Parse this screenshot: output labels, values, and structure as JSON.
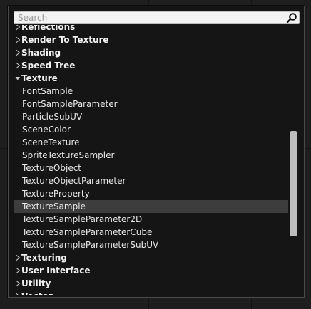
{
  "search": {
    "placeholder": "Search",
    "value": ""
  },
  "icons": {
    "search": "magnifier-icon",
    "collapsed": "triangle-right-outline-icon",
    "expanded": "triangle-down-filled-icon"
  },
  "colors": {
    "panel_bg": "#151515",
    "selection": "#3d3d3d",
    "scrollbar_thumb": "#bdbdbd",
    "search_bg": "#f2f2f2"
  },
  "scrollbar": {
    "position_fraction": 0.58,
    "visible_fraction": 0.4
  },
  "list": {
    "rows": [
      {
        "type": "category",
        "label": "Reflections",
        "expanded": false
      },
      {
        "type": "category",
        "label": "Render To Texture",
        "expanded": false
      },
      {
        "type": "category",
        "label": "Shading",
        "expanded": false
      },
      {
        "type": "category",
        "label": "Speed Tree",
        "expanded": false
      },
      {
        "type": "category",
        "label": "Texture",
        "expanded": true
      },
      {
        "type": "item",
        "label": "FontSample"
      },
      {
        "type": "item",
        "label": "FontSampleParameter"
      },
      {
        "type": "item",
        "label": "ParticleSubUV"
      },
      {
        "type": "item",
        "label": "SceneColor"
      },
      {
        "type": "item",
        "label": "SceneTexture"
      },
      {
        "type": "item",
        "label": "SpriteTextureSampler"
      },
      {
        "type": "item",
        "label": "TextureObject"
      },
      {
        "type": "item",
        "label": "TextureObjectParameter"
      },
      {
        "type": "item",
        "label": "TextureProperty"
      },
      {
        "type": "item",
        "label": "TextureSample",
        "selected": true
      },
      {
        "type": "item",
        "label": "TextureSampleParameter2D"
      },
      {
        "type": "item",
        "label": "TextureSampleParameterCube"
      },
      {
        "type": "item",
        "label": "TextureSampleParameterSubUV"
      },
      {
        "type": "category",
        "label": "Texturing",
        "expanded": false
      },
      {
        "type": "category",
        "label": "User Interface",
        "expanded": false
      },
      {
        "type": "category",
        "label": "Utility",
        "expanded": false
      },
      {
        "type": "category",
        "label": "Vector",
        "expanded": false
      }
    ]
  }
}
